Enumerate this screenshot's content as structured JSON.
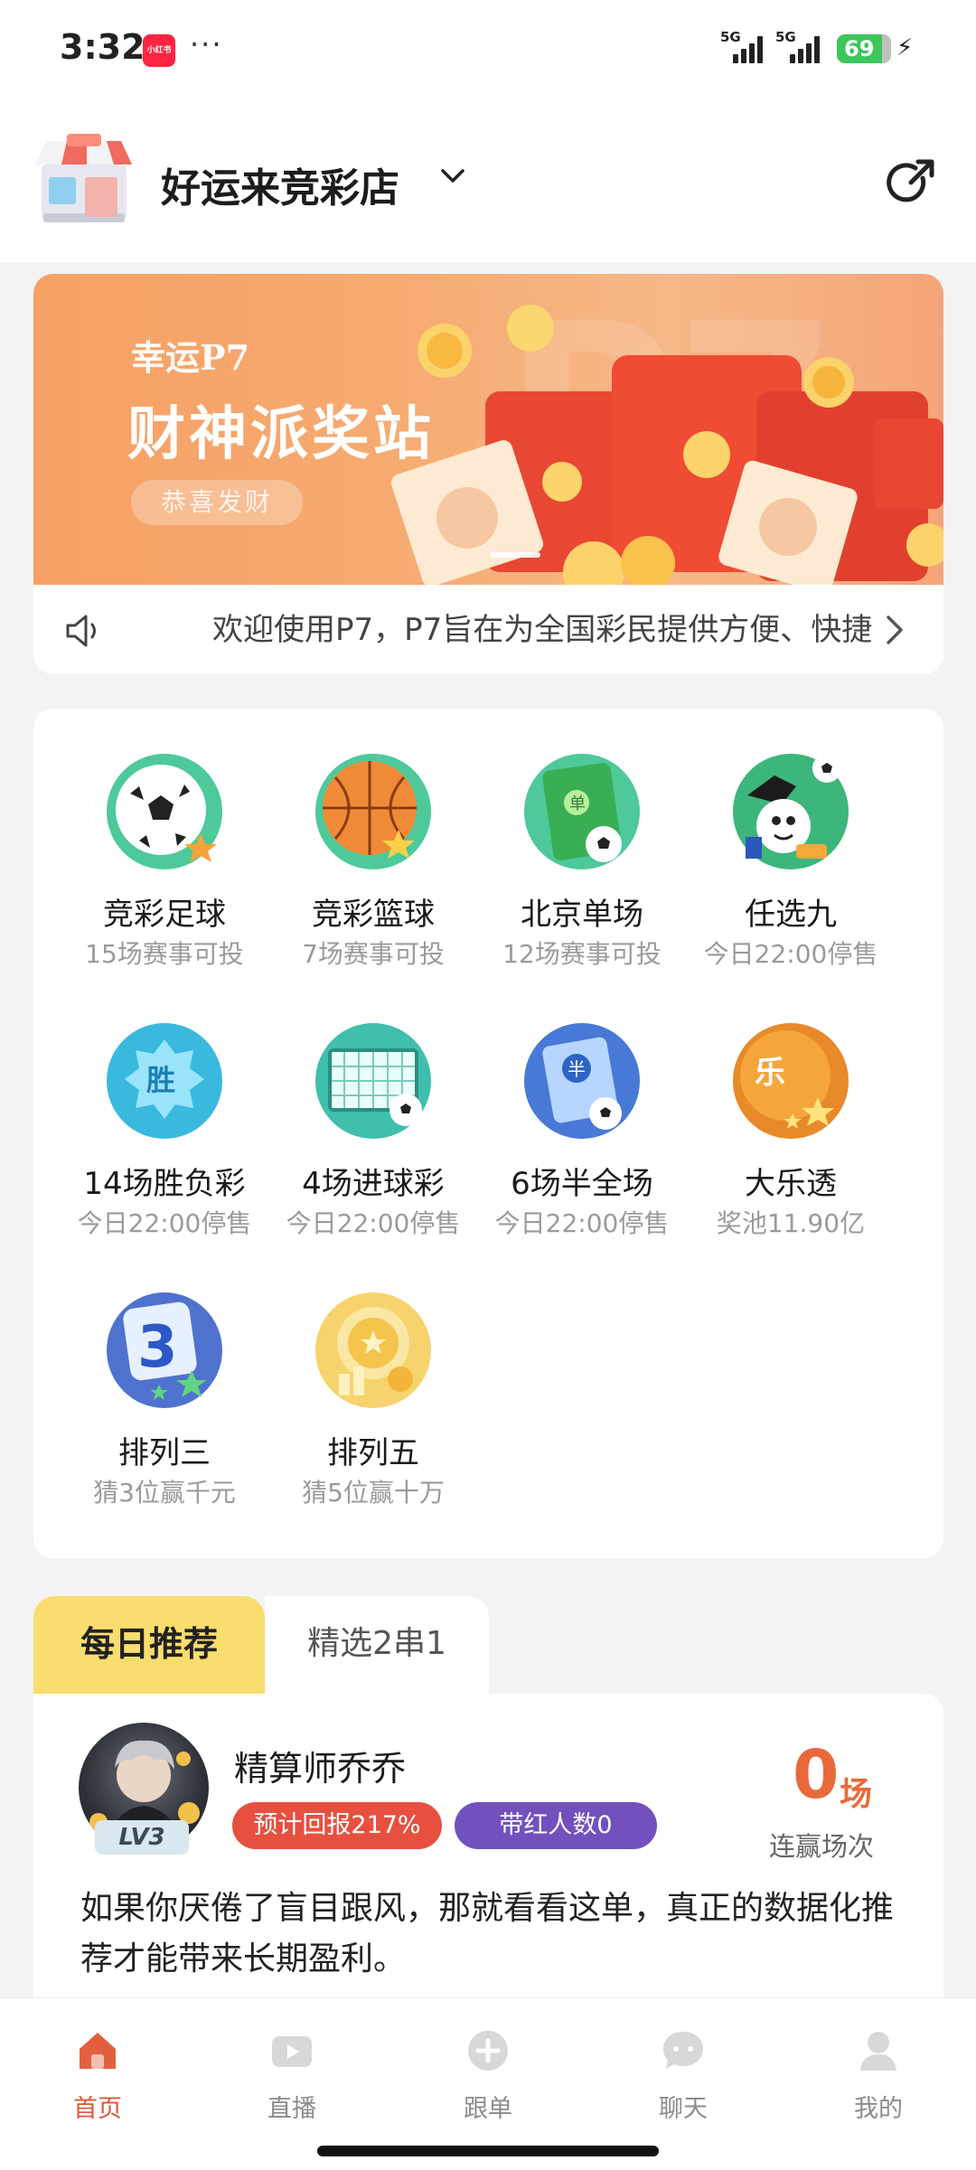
{
  "status_bar": {
    "time": "3:32",
    "app_badge": "小红书",
    "more": "···",
    "network1": "5G",
    "network2": "5G",
    "battery": "69"
  },
  "header": {
    "store_name": "好运来竞彩店"
  },
  "banner": {
    "small_title": "幸运P7",
    "big_title": "财神派奖站",
    "pill": "恭喜发财"
  },
  "notice": {
    "text": "欢迎使用P7，P7旨在为全国彩民提供方便、快捷"
  },
  "games": [
    {
      "name": "竞彩足球",
      "sub": "15场赛事可投",
      "icon": "football-icon"
    },
    {
      "name": "竞彩篮球",
      "sub": "7场赛事可投",
      "icon": "basketball-icon"
    },
    {
      "name": "北京单场",
      "sub": "12场赛事可投",
      "icon": "field-single-icon"
    },
    {
      "name": "任选九",
      "sub": "今日22:00停售",
      "icon": "mascot-nine-icon"
    },
    {
      "name": "14场胜负彩",
      "sub": "今日22:00停售",
      "icon": "win-badge-icon"
    },
    {
      "name": "4场进球彩",
      "sub": "今日22:00停售",
      "icon": "goal-net-icon"
    },
    {
      "name": "6场半全场",
      "sub": "今日22:00停售",
      "icon": "half-ticket-icon"
    },
    {
      "name": "大乐透",
      "sub": "奖池11.90亿",
      "icon": "le-coin-icon"
    },
    {
      "name": "排列三",
      "sub": "猜3位赢千元",
      "icon": "three-cube-icon"
    },
    {
      "name": "排列五",
      "sub": "猜5位赢十万",
      "icon": "gold-coin-five-icon"
    }
  ],
  "rec_tabs": {
    "active": "每日推荐",
    "inactive": "精选2串1"
  },
  "recommendation": {
    "name": "精算师乔乔",
    "level": "LV3",
    "return_pill": "预计回报217%",
    "followers_pill": "带红人数0",
    "streak_number": "0",
    "streak_unit": "场",
    "streak_label": "连赢场次",
    "text": "如果你厌倦了盲目跟风，那就看看这单，真正的数据化推荐才能带来长期盈利。"
  },
  "tabbar": [
    {
      "label": "首页",
      "icon": "home-icon",
      "active": true
    },
    {
      "label": "直播",
      "icon": "play-icon",
      "active": false
    },
    {
      "label": "跟单",
      "icon": "plus-circle-icon",
      "active": false
    },
    {
      "label": "聊天",
      "icon": "chat-icon",
      "active": false
    },
    {
      "label": "我的",
      "icon": "profile-icon",
      "active": false
    }
  ],
  "colors": {
    "accent": "#d9573a",
    "tab_yellow": "#f9dd6e",
    "pill_red": "#e7503f",
    "pill_purple": "#7251be"
  }
}
